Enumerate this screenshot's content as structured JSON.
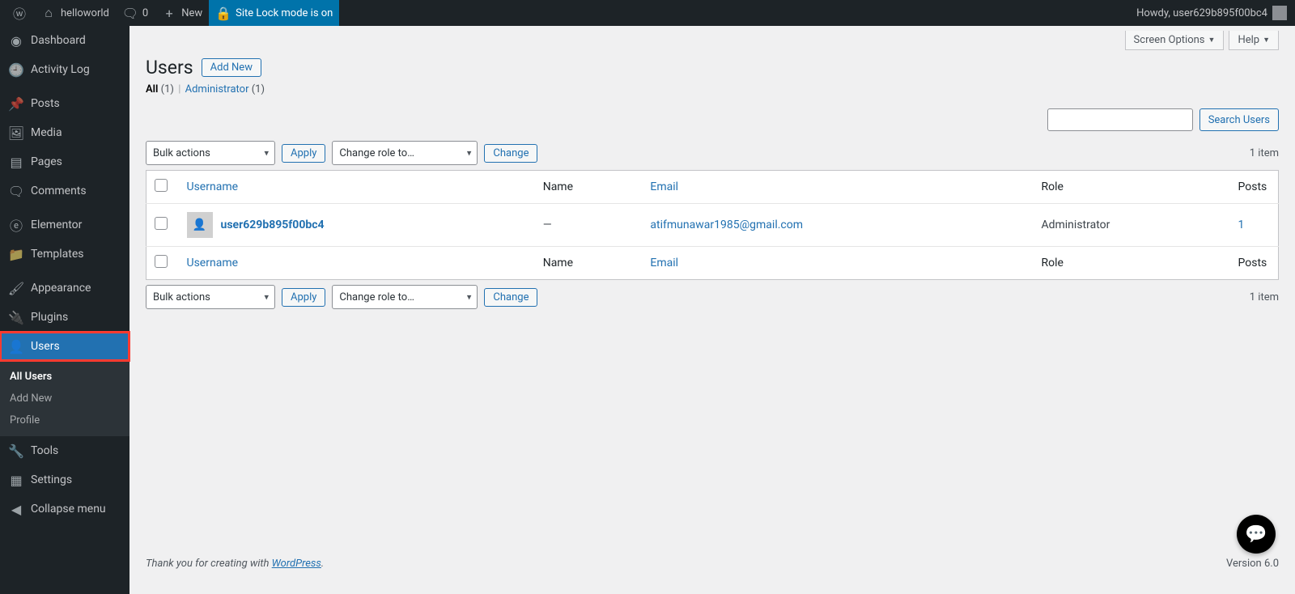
{
  "adminbar": {
    "site": "helloworld",
    "comments": "0",
    "new": "New",
    "lock": "Site Lock mode is on",
    "howdy": "Howdy, user629b895f00bc4"
  },
  "sidebar": {
    "items": [
      {
        "label": "Dashboard"
      },
      {
        "label": "Activity Log"
      },
      {
        "label": "Posts"
      },
      {
        "label": "Media"
      },
      {
        "label": "Pages"
      },
      {
        "label": "Comments"
      },
      {
        "label": "Elementor"
      },
      {
        "label": "Templates"
      },
      {
        "label": "Appearance"
      },
      {
        "label": "Plugins"
      },
      {
        "label": "Users"
      },
      {
        "label": "Tools"
      },
      {
        "label": "Settings"
      },
      {
        "label": "Collapse menu"
      }
    ],
    "sub": {
      "all_users": "All Users",
      "add_new": "Add New",
      "profile": "Profile"
    }
  },
  "tabs": {
    "screen": "Screen Options",
    "help": "Help"
  },
  "page": {
    "title": "Users",
    "add_new": "Add New",
    "filter_all": "All",
    "filter_all_count": "(1)",
    "filter_admin": "Administrator",
    "filter_admin_count": "(1)",
    "bulk_label": "Bulk actions",
    "apply": "Apply",
    "role_label": "Change role to…",
    "change": "Change",
    "items": "1 item",
    "search_btn": "Search Users"
  },
  "table": {
    "th_username": "Username",
    "th_name": "Name",
    "th_email": "Email",
    "th_role": "Role",
    "th_posts": "Posts",
    "rows": [
      {
        "username": "user629b895f00bc4",
        "name": "—",
        "email": "atifmunawar1985@gmail.com",
        "role": "Administrator",
        "posts": "1"
      }
    ]
  },
  "footer": {
    "thanks_pre": "Thank you for creating with ",
    "wp": "WordPress",
    "dot": ".",
    "version": "Version 6.0"
  }
}
